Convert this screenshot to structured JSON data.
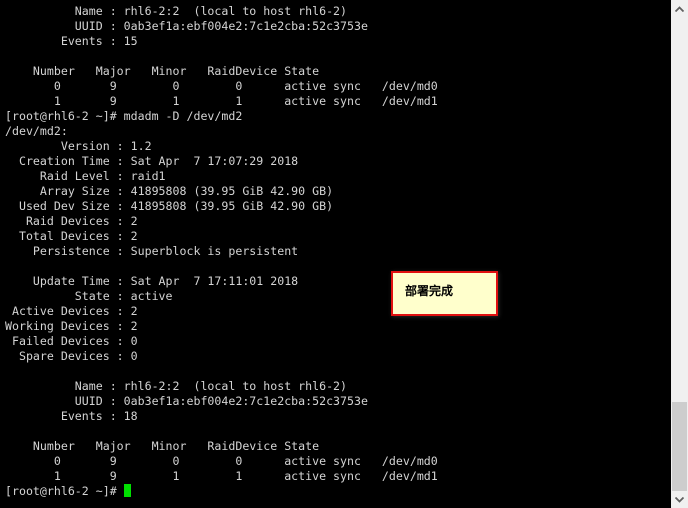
{
  "terminal": {
    "lines": [
      "          Name : rhl6-2:2  (local to host rhl6-2)",
      "          UUID : 0ab3ef1a:ebf004e2:7c1e2cba:52c3753e",
      "        Events : 15",
      "",
      "    Number   Major   Minor   RaidDevice State",
      "       0       9        0        0      active sync   /dev/md0",
      "       1       9        1        1      active sync   /dev/md1",
      "[root@rhl6-2 ~]# mdadm -D /dev/md2",
      "/dev/md2:",
      "        Version : 1.2",
      "  Creation Time : Sat Apr  7 17:07:29 2018",
      "     Raid Level : raid1",
      "     Array Size : 41895808 (39.95 GiB 42.90 GB)",
      "  Used Dev Size : 41895808 (39.95 GiB 42.90 GB)",
      "   Raid Devices : 2",
      "  Total Devices : 2",
      "    Persistence : Superblock is persistent",
      "",
      "    Update Time : Sat Apr  7 17:11:01 2018",
      "          State : active",
      " Active Devices : 2",
      "Working Devices : 2",
      " Failed Devices : 0",
      "  Spare Devices : 0",
      "",
      "          Name : rhl6-2:2  (local to host rhl6-2)",
      "          UUID : 0ab3ef1a:ebf004e2:7c1e2cba:52c3753e",
      "        Events : 18",
      "",
      "    Number   Major   Minor   RaidDevice State",
      "       0       9        0        0      active sync   /dev/md0",
      "       1       9        1        1      active sync   /dev/md1"
    ],
    "prompt": "[root@rhl6-2 ~]# ",
    "cursor_color": "#00e000",
    "text_color": "#d4d4d4",
    "background": "#000000"
  },
  "annotation": {
    "text": "部署完成",
    "border_color": "#e01010",
    "background": "#ffffcc"
  },
  "scrollbar": {
    "up_icon": "▲",
    "down_icon": "▼",
    "position_fraction": 0.93
  }
}
